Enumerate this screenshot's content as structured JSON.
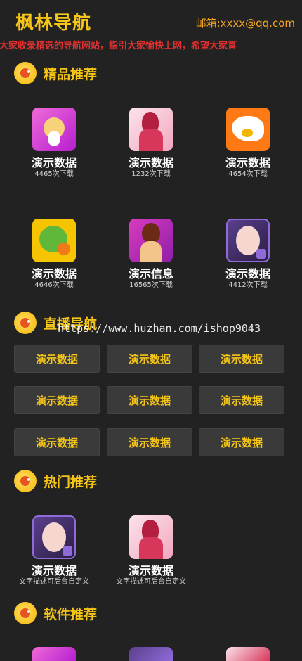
{
  "header": {
    "title": "枫林导航",
    "email": "邮箱:xxxx@qq.com",
    "marquee": "为大家收录精选的导航网站，指引大家愉快上网，希望大家喜"
  },
  "sections": {
    "featured": {
      "title": "精品推荐",
      "apps": [
        {
          "name": "演示数据",
          "sub": "4465次下载",
          "icon": "deer-app-icon"
        },
        {
          "name": "演示数据",
          "sub": "1232次下载",
          "icon": "girl-app-icon"
        },
        {
          "name": "演示数据",
          "sub": "4654次下载",
          "icon": "shark-app-icon"
        },
        {
          "name": "演示数据",
          "sub": "4646次下载",
          "icon": "dragon-app-icon"
        },
        {
          "name": "演示信息",
          "sub": "16565次下载",
          "icon": "girl-app-icon"
        },
        {
          "name": "演示数据",
          "sub": "4412次下载",
          "icon": "girl-photo-app-icon"
        }
      ]
    },
    "live": {
      "title": "直播导航",
      "buttons": [
        "演示数据",
        "演示数据",
        "演示数据",
        "演示数据",
        "演示数据",
        "演示数据",
        "演示数据",
        "演示数据",
        "演示数据"
      ]
    },
    "hot": {
      "title": "热门推荐",
      "apps": [
        {
          "name": "演示数据",
          "sub": "文字描述可后台自定义",
          "icon": "girl-photo-app-icon"
        },
        {
          "name": "演示数据",
          "sub": "文字描述可后台自定义",
          "icon": "girl-app-icon"
        }
      ]
    },
    "software": {
      "title": "软件推荐"
    }
  },
  "watermark": "https://www.huzhan.com/ishop9043",
  "colors": {
    "background": "#222222",
    "accent": "#f5c518",
    "email": "#f5a623",
    "marquee": "#e03030",
    "button_bg": "#3a3a3a"
  }
}
